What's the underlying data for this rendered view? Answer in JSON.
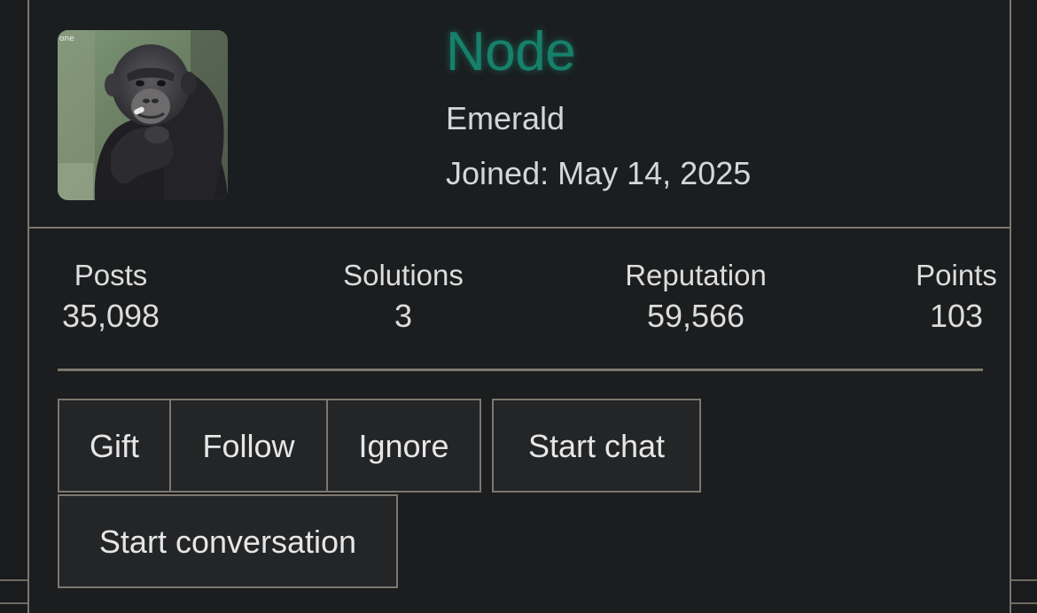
{
  "profile": {
    "name": "Node",
    "title": "Emerald",
    "joined_label": "Joined:",
    "joined_date": "May 14, 2025",
    "name_color": "#17806b",
    "avatar_icon": "chimpanzee-avatar-photo",
    "avatar_caption": "one"
  },
  "stats": {
    "posts": {
      "label": "Posts",
      "value": "35,098"
    },
    "solutions": {
      "label": "Solutions",
      "value": "3"
    },
    "reputation": {
      "label": "Reputation",
      "value": "59,566"
    },
    "points": {
      "label": "Points",
      "value": "103"
    }
  },
  "actions": {
    "gift": "Gift",
    "follow": "Follow",
    "ignore": "Ignore",
    "start_chat": "Start chat",
    "start_conversation": "Start conversation"
  },
  "colors": {
    "background": "#191b1d",
    "border": "#7d776e",
    "button_bg": "#232527",
    "text": "#dcdcdc"
  }
}
